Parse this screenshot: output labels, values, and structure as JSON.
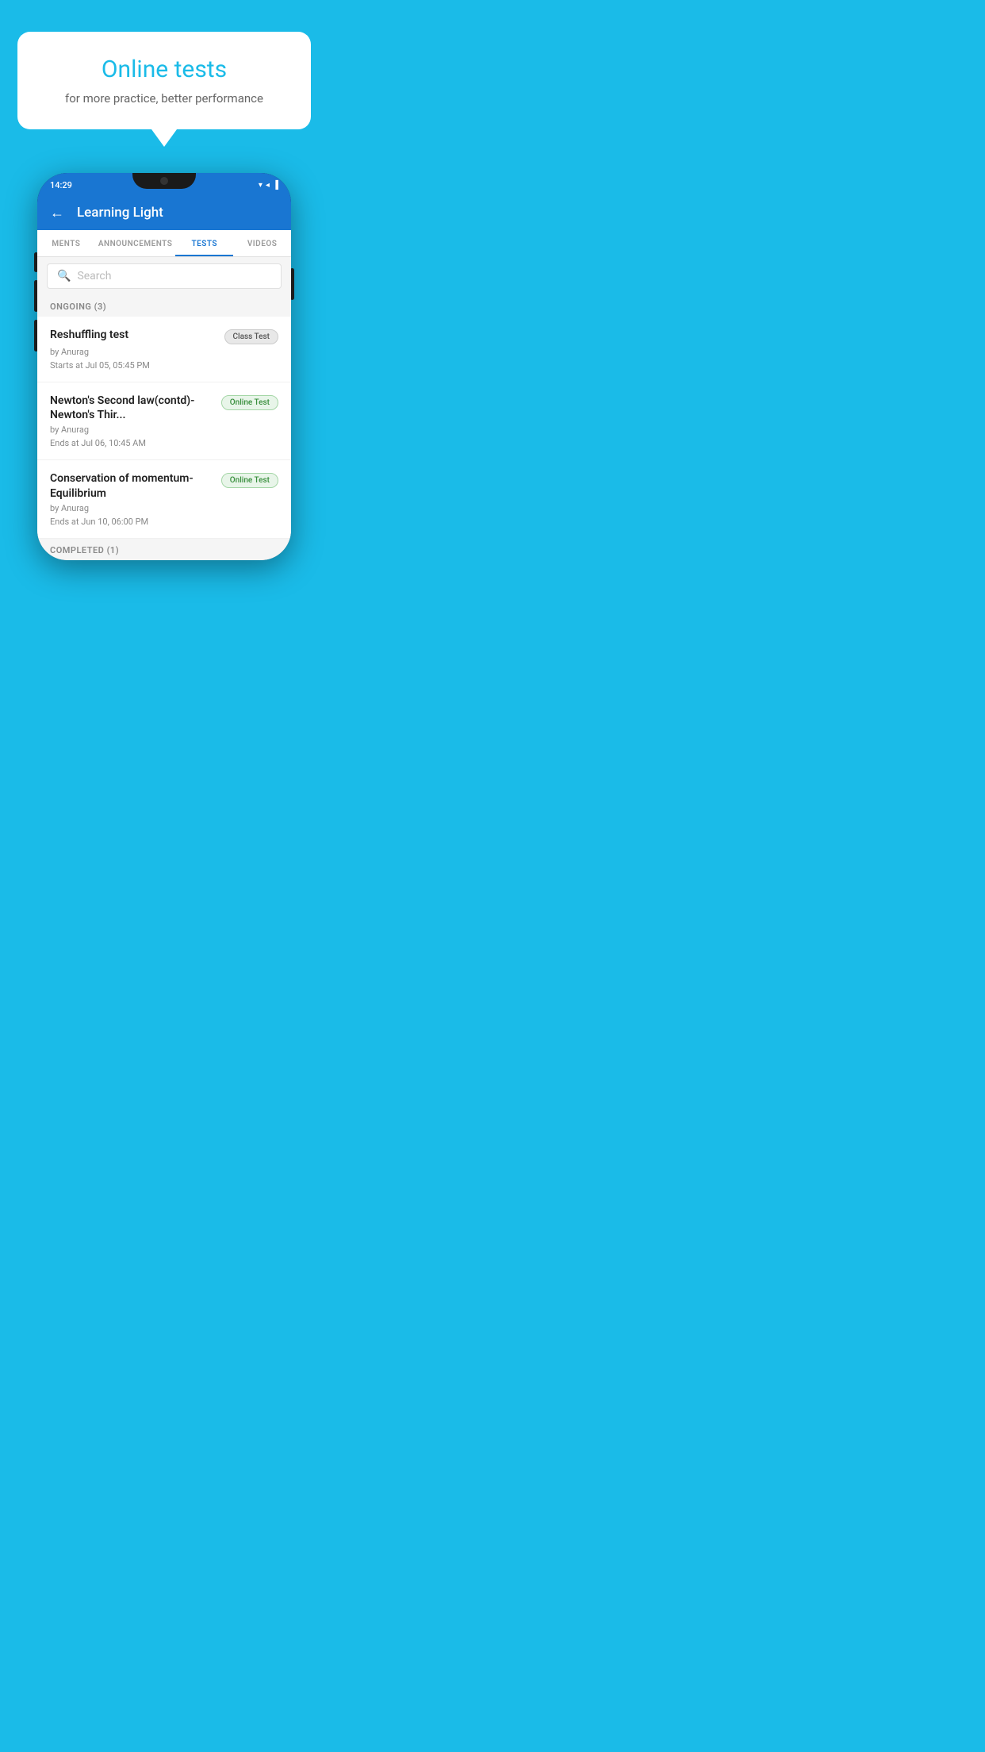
{
  "background_color": "#1ABBE8",
  "speech_bubble": {
    "title": "Online tests",
    "subtitle": "for more practice, better performance"
  },
  "phone": {
    "status_bar": {
      "time": "14:29",
      "icons": "▼ ◀ ▌"
    },
    "header": {
      "back_label": "←",
      "title": "Learning Light"
    },
    "tabs": [
      {
        "label": "MENTS",
        "active": false
      },
      {
        "label": "ANNOUNCEMENTS",
        "active": false
      },
      {
        "label": "TESTS",
        "active": true
      },
      {
        "label": "VIDEOS",
        "active": false
      }
    ],
    "search": {
      "placeholder": "Search"
    },
    "ongoing_section": {
      "label": "ONGOING (3)",
      "tests": [
        {
          "name": "Reshuffling test",
          "badge": "Class Test",
          "badge_type": "class",
          "author": "by Anurag",
          "time_label": "Starts at",
          "time": "Jul 05, 05:45 PM"
        },
        {
          "name": "Newton's Second law(contd)-Newton's Thir...",
          "badge": "Online Test",
          "badge_type": "online",
          "author": "by Anurag",
          "time_label": "Ends at",
          "time": "Jul 06, 10:45 AM"
        },
        {
          "name": "Conservation of momentum-Equilibrium",
          "badge": "Online Test",
          "badge_type": "online",
          "author": "by Anurag",
          "time_label": "Ends at",
          "time": "Jun 10, 06:00 PM"
        }
      ]
    },
    "completed_section": {
      "label": "COMPLETED (1)"
    }
  }
}
